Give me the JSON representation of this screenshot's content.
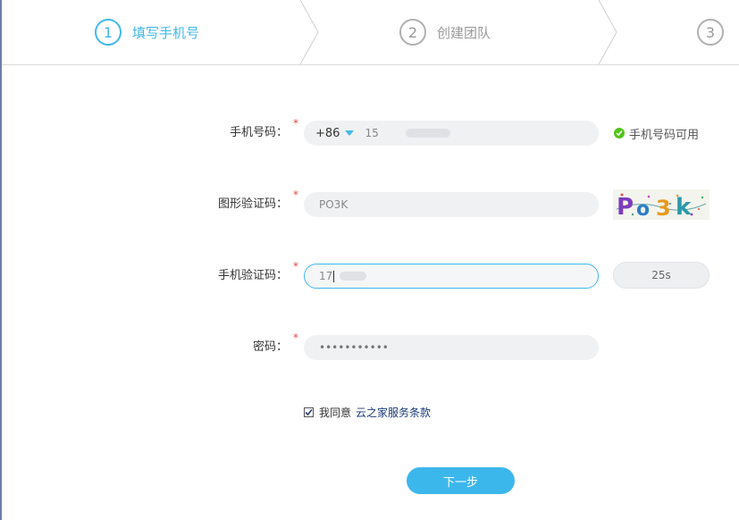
{
  "steps": [
    {
      "number": "1",
      "label": "填写手机号"
    },
    {
      "number": "2",
      "label": "创建团队"
    },
    {
      "number": "3",
      "label": ""
    }
  ],
  "form": {
    "phone": {
      "label": "手机号码：",
      "required_mark": "*",
      "country_code": "+86",
      "value": "15",
      "status": "手机号码可用"
    },
    "captcha": {
      "label": "图形验证码：",
      "required_mark": "*",
      "value": "PO3K",
      "image_text": "Po3k"
    },
    "sms": {
      "label": "手机验证码：",
      "required_mark": "*",
      "value": "17",
      "countdown": "25s"
    },
    "password": {
      "label": "密码：",
      "required_mark": "*",
      "value": "•••••••••••"
    }
  },
  "agreement": {
    "checked": true,
    "text": "我同意",
    "link": "云之家服务条款"
  },
  "next_button": {
    "label": "下一步"
  },
  "colors": {
    "accent": "#41b8ec",
    "success": "#52c41a",
    "required": "#e04a4a"
  }
}
